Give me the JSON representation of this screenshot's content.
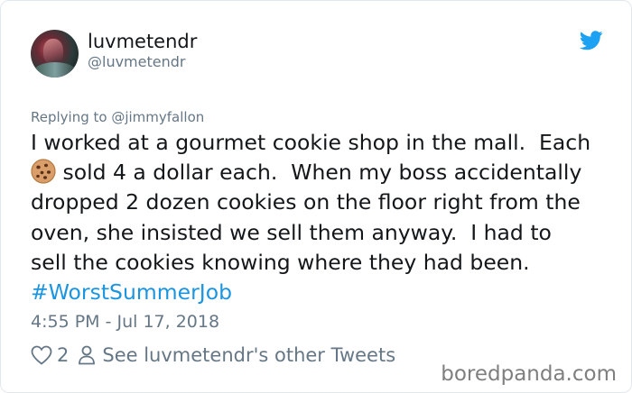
{
  "user": {
    "display_name": "luvmetendr",
    "handle": "@luvmetendr"
  },
  "reply": {
    "prefix": "Replying to ",
    "mention": "@jimmyfallon"
  },
  "tweet": {
    "lines": [
      "I worked at a gourmet cookie shop in the mall.  Each",
      " sold 4 a dollar each.  When my boss accidentally",
      "dropped 2 dozen cookies on the floor right from the",
      "oven, she insisted we sell them anyway.  I had to",
      "sell the cookies knowing where they had been."
    ],
    "emoji": "cookie",
    "hashtag": "#WorstSummerJob"
  },
  "timestamp": "4:55 PM - Jul 17, 2018",
  "actions": {
    "like_count": "2",
    "other_tweets_label": "See luvmetendr's other Tweets"
  },
  "watermark": "boredpanda.com",
  "colors": {
    "twitter_blue": "#1da1f2",
    "link_blue": "#1b95e0",
    "secondary_gray": "#657786",
    "text": "#14171a"
  },
  "icons": [
    "twitter-bird-icon",
    "cookie-emoji-icon",
    "heart-icon",
    "person-icon"
  ]
}
